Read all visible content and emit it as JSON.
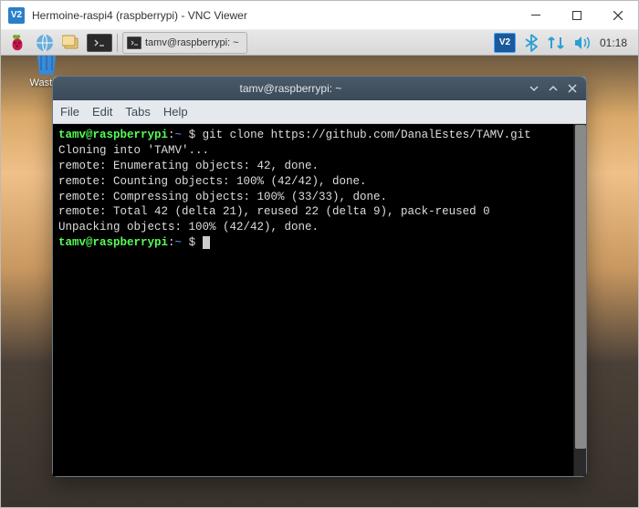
{
  "window": {
    "title": "Hermoine-raspi4 (raspberrypi) - VNC Viewer",
    "app_icon_text": "V2"
  },
  "taskbar": {
    "task_label": "tamv@raspberrypi: ~",
    "vnc_tray": "V2",
    "clock": "01:18"
  },
  "desktop": {
    "wastebasket": "Wasteb"
  },
  "terminal": {
    "title": "tamv@raspberrypi: ~",
    "menu": {
      "file": "File",
      "edit": "Edit",
      "tabs": "Tabs",
      "help": "Help"
    },
    "lines": {
      "prompt1_user": "tamv@raspberrypi",
      "prompt1_path": "~",
      "prompt1_sep": ":",
      "prompt1_dollar": " $ ",
      "cmd": "git clone https://github.com/DanalEstes/TAMV.git",
      "l1": "Cloning into 'TAMV'...",
      "l2": "remote: Enumerating objects: 42, done.",
      "l3": "remote: Counting objects: 100% (42/42), done.",
      "l4": "remote: Compressing objects: 100% (33/33), done.",
      "l5": "remote: Total 42 (delta 21), reused 22 (delta 9), pack-reused 0",
      "l6": "Unpacking objects: 100% (42/42), done.",
      "prompt2_user": "tamv@raspberrypi",
      "prompt2_path": "~",
      "prompt2_sep": ":",
      "prompt2_dollar": " $ "
    }
  }
}
